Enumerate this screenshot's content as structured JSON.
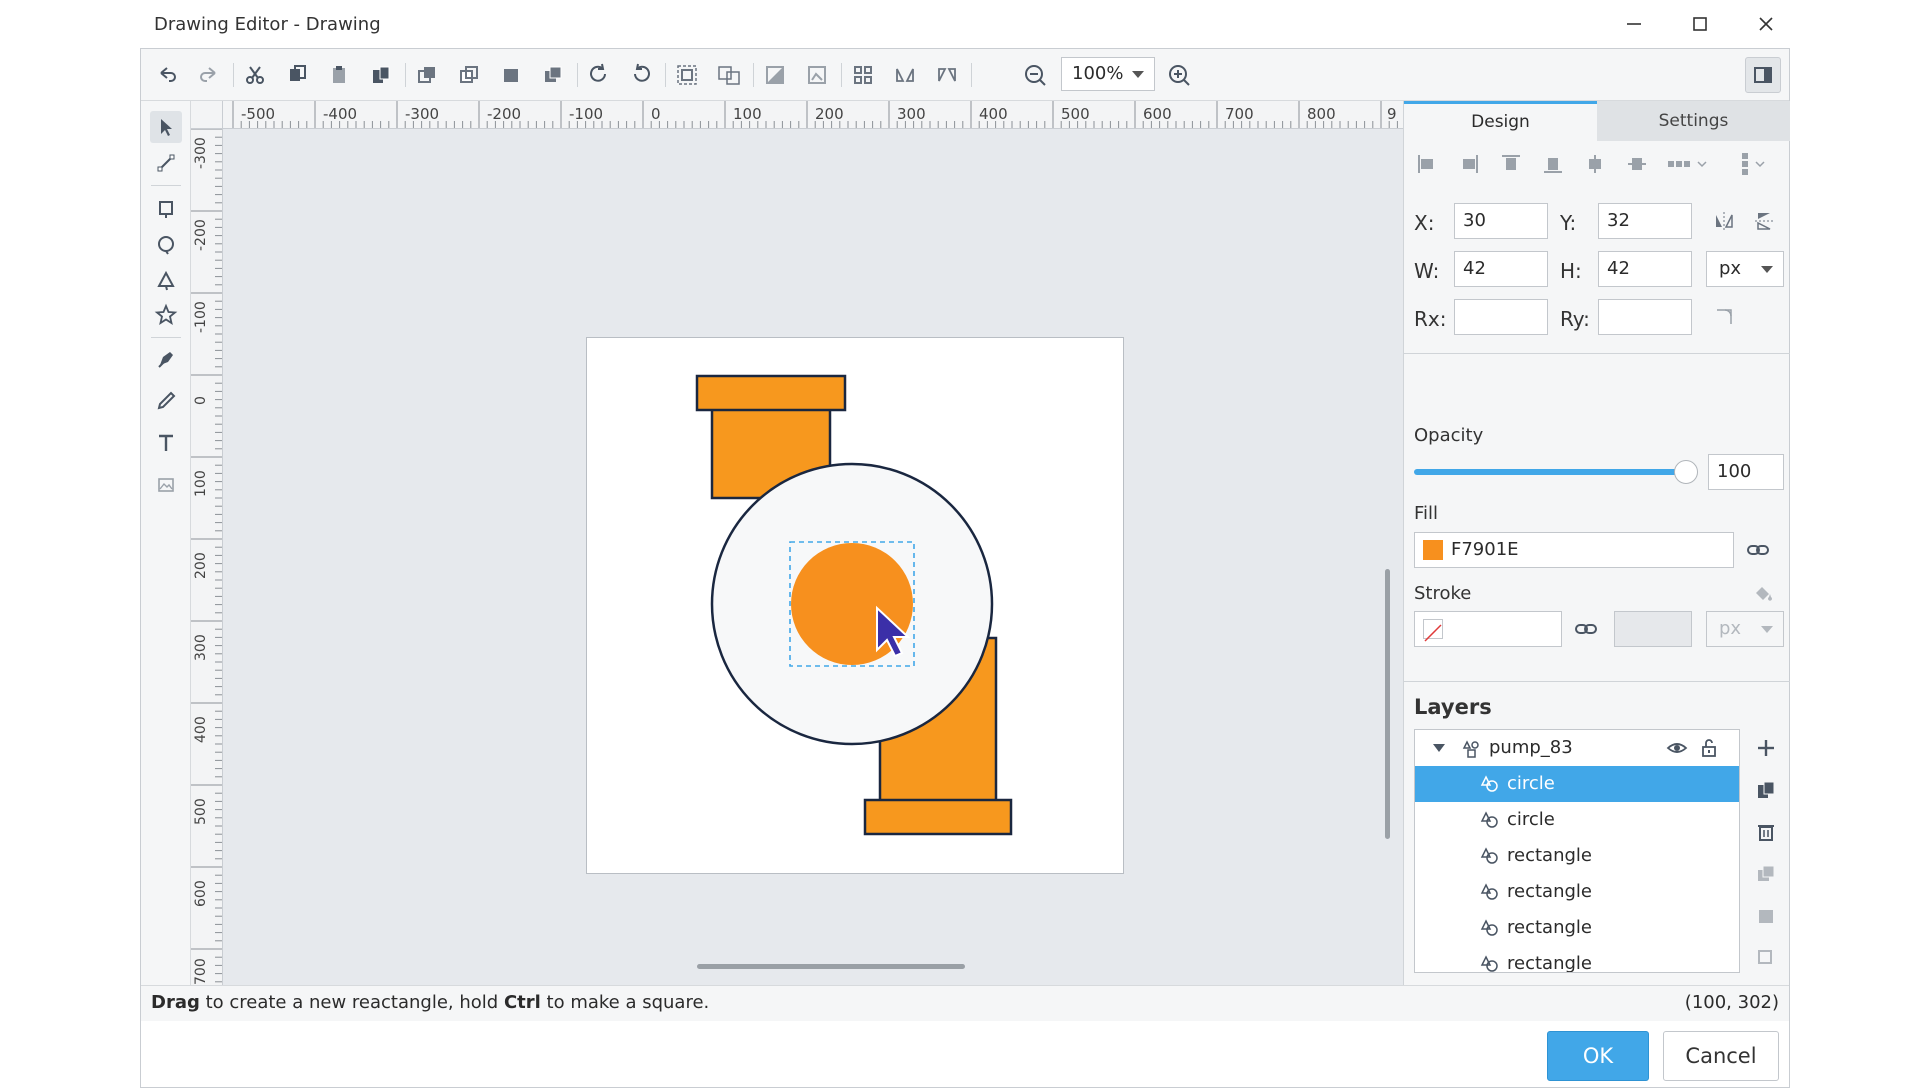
{
  "window": {
    "title": "Drawing Editor - Drawing"
  },
  "toolbar": {
    "zoom": "100%"
  },
  "ruler": {
    "top": [
      "-500",
      "-400",
      "-300",
      "-200",
      "-100",
      "0",
      "100",
      "200",
      "300",
      "400",
      "500",
      "600",
      "700",
      "800",
      "9"
    ],
    "left": [
      "-300",
      "-200",
      "-100",
      "0",
      "100",
      "200",
      "300",
      "400",
      "500",
      "600",
      "700"
    ]
  },
  "drawing": {
    "fill_color": "#F7901E",
    "stroke_color": "#1a2740",
    "pipe_color": "#F7981E",
    "circle_bg": "#f7f8f9"
  },
  "panel": {
    "tabs": {
      "design": "Design",
      "settings": "Settings"
    },
    "x_label": "X:",
    "x_value": "30",
    "y_label": "Y:",
    "y_value": "32",
    "w_label": "W:",
    "w_value": "42",
    "h_label": "H:",
    "h_value": "42",
    "rx_label": "Rx:",
    "rx_value": "",
    "ry_label": "Ry:",
    "ry_value": "",
    "unit": "px",
    "opacity_label": "Opacity",
    "opacity_value": "100",
    "opacity_level": 1.0,
    "fill_label": "Fill",
    "fill_value": "F7901E",
    "stroke_label": "Stroke",
    "stroke_value": "",
    "stroke_unit": "px"
  },
  "layers": {
    "title": "Layers",
    "group": "pump_83",
    "items": [
      {
        "name": "circle",
        "selected": true
      },
      {
        "name": "circle",
        "selected": false
      },
      {
        "name": "rectangle",
        "selected": false
      },
      {
        "name": "rectangle",
        "selected": false
      },
      {
        "name": "rectangle",
        "selected": false
      },
      {
        "name": "rectangle",
        "selected": false
      }
    ]
  },
  "status": {
    "drag": "Drag",
    "text1": " to create a new reactangle, hold ",
    "ctrl": "Ctrl",
    "text2": " to make a square.",
    "coords": "(100, 302)"
  },
  "buttons": {
    "ok": "OK",
    "cancel": "Cancel"
  },
  "colors": {
    "accent": "#41a7e8"
  }
}
